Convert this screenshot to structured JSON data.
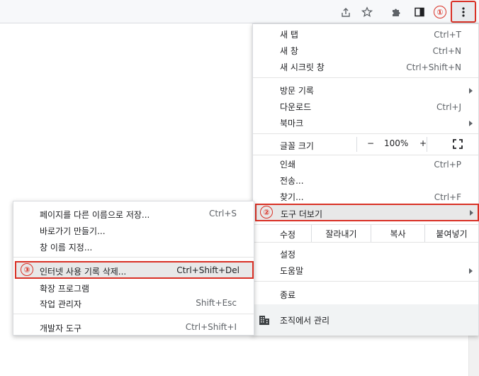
{
  "annotations": {
    "step1": "①",
    "step2": "②",
    "step3": "③"
  },
  "colors": {
    "annotation": "#d93025",
    "highlight": "#e8e8e8",
    "toolbar": "#f7f8fa"
  },
  "toolbar": {
    "icons": [
      "share-icon",
      "star-icon",
      "extensions-icon",
      "side-panel-icon",
      "more-vert-icon"
    ]
  },
  "main_menu": {
    "new_tab": {
      "label": "새 탭",
      "shortcut": "Ctrl+T"
    },
    "new_window": {
      "label": "새 창",
      "shortcut": "Ctrl+N"
    },
    "new_incognito": {
      "label": "새 시크릿 창",
      "shortcut": "Ctrl+Shift+N"
    },
    "history": {
      "label": "방문 기록"
    },
    "downloads": {
      "label": "다운로드",
      "shortcut": "Ctrl+J"
    },
    "bookmarks": {
      "label": "북마크"
    },
    "zoom": {
      "label": "글꼴 크기",
      "minus": "−",
      "value": "100%",
      "plus": "+"
    },
    "print": {
      "label": "인쇄",
      "shortcut": "Ctrl+P"
    },
    "cast": {
      "label": "전송..."
    },
    "find": {
      "label": "찾기...",
      "shortcut": "Ctrl+F"
    },
    "more_tools": {
      "label": "도구 더보기"
    },
    "edit": {
      "label": "수정",
      "cut": "잘라내기",
      "copy": "복사",
      "paste": "붙여넣기"
    },
    "settings": {
      "label": "설정"
    },
    "help": {
      "label": "도움말"
    },
    "exit": {
      "label": "종료"
    },
    "managed": {
      "label": "조직에서 관리"
    }
  },
  "sub_menu": {
    "save_page": {
      "label": "페이지를 다른 이름으로 저장...",
      "shortcut": "Ctrl+S"
    },
    "create_shortcut": {
      "label": "바로가기 만들기..."
    },
    "name_window": {
      "label": "창 이름 지정..."
    },
    "clear_data": {
      "label": "인터넷 사용 기록 삭제...",
      "shortcut": "Ctrl+Shift+Del"
    },
    "extensions": {
      "label": "확장 프로그램"
    },
    "task_manager": {
      "label": "작업 관리자",
      "shortcut": "Shift+Esc"
    },
    "dev_tools": {
      "label": "개발자 도구",
      "shortcut": "Ctrl+Shift+I"
    }
  }
}
